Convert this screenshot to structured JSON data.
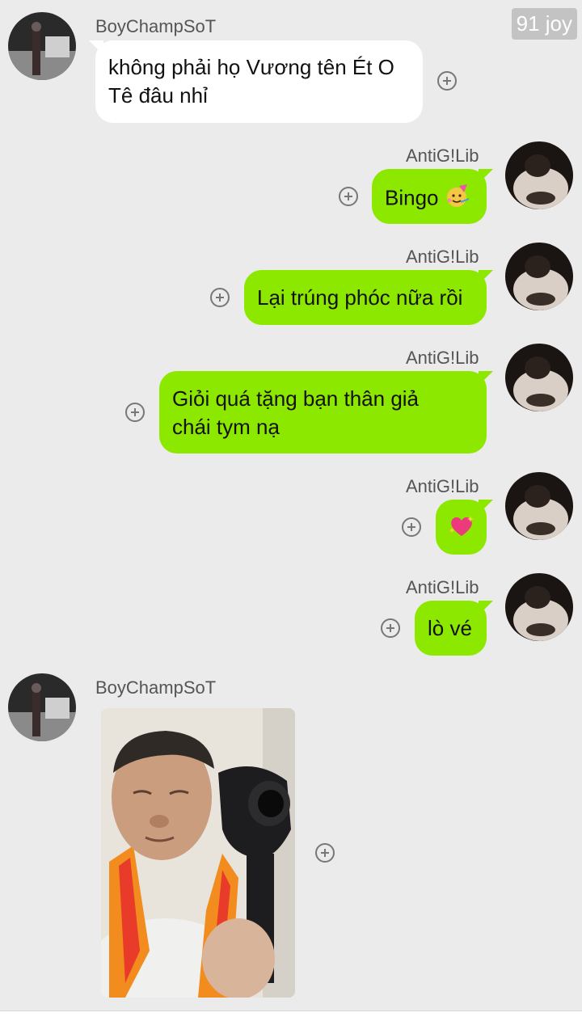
{
  "watermark": "91 joy",
  "messages": [
    {
      "sender": "BoyChampSoT",
      "text_lines": [
        "không phải họ Vương tên Ét O",
        "Tê đâu nhỉ"
      ]
    },
    {
      "sender": "AntiG!Lib",
      "text": "Bingo",
      "emoji": "partying-face-emoji"
    },
    {
      "sender": "AntiG!Lib",
      "text": "Lại trúng phóc nữa rồi"
    },
    {
      "sender": "AntiG!Lib",
      "text_lines": [
        "Giỏi quá tặng bạn thân giả",
        "chái tym nạ"
      ]
    },
    {
      "sender": "AntiG!Lib",
      "emoji": "sparkling-heart-emoji"
    },
    {
      "sender": "AntiG!Lib",
      "text": "lò vé"
    },
    {
      "sender": "BoyChampSoT",
      "image": "photo-message"
    }
  ],
  "colors": {
    "background": "#ebebeb",
    "incoming_bubble": "#ffffff",
    "outgoing_bubble": "#8de800"
  }
}
